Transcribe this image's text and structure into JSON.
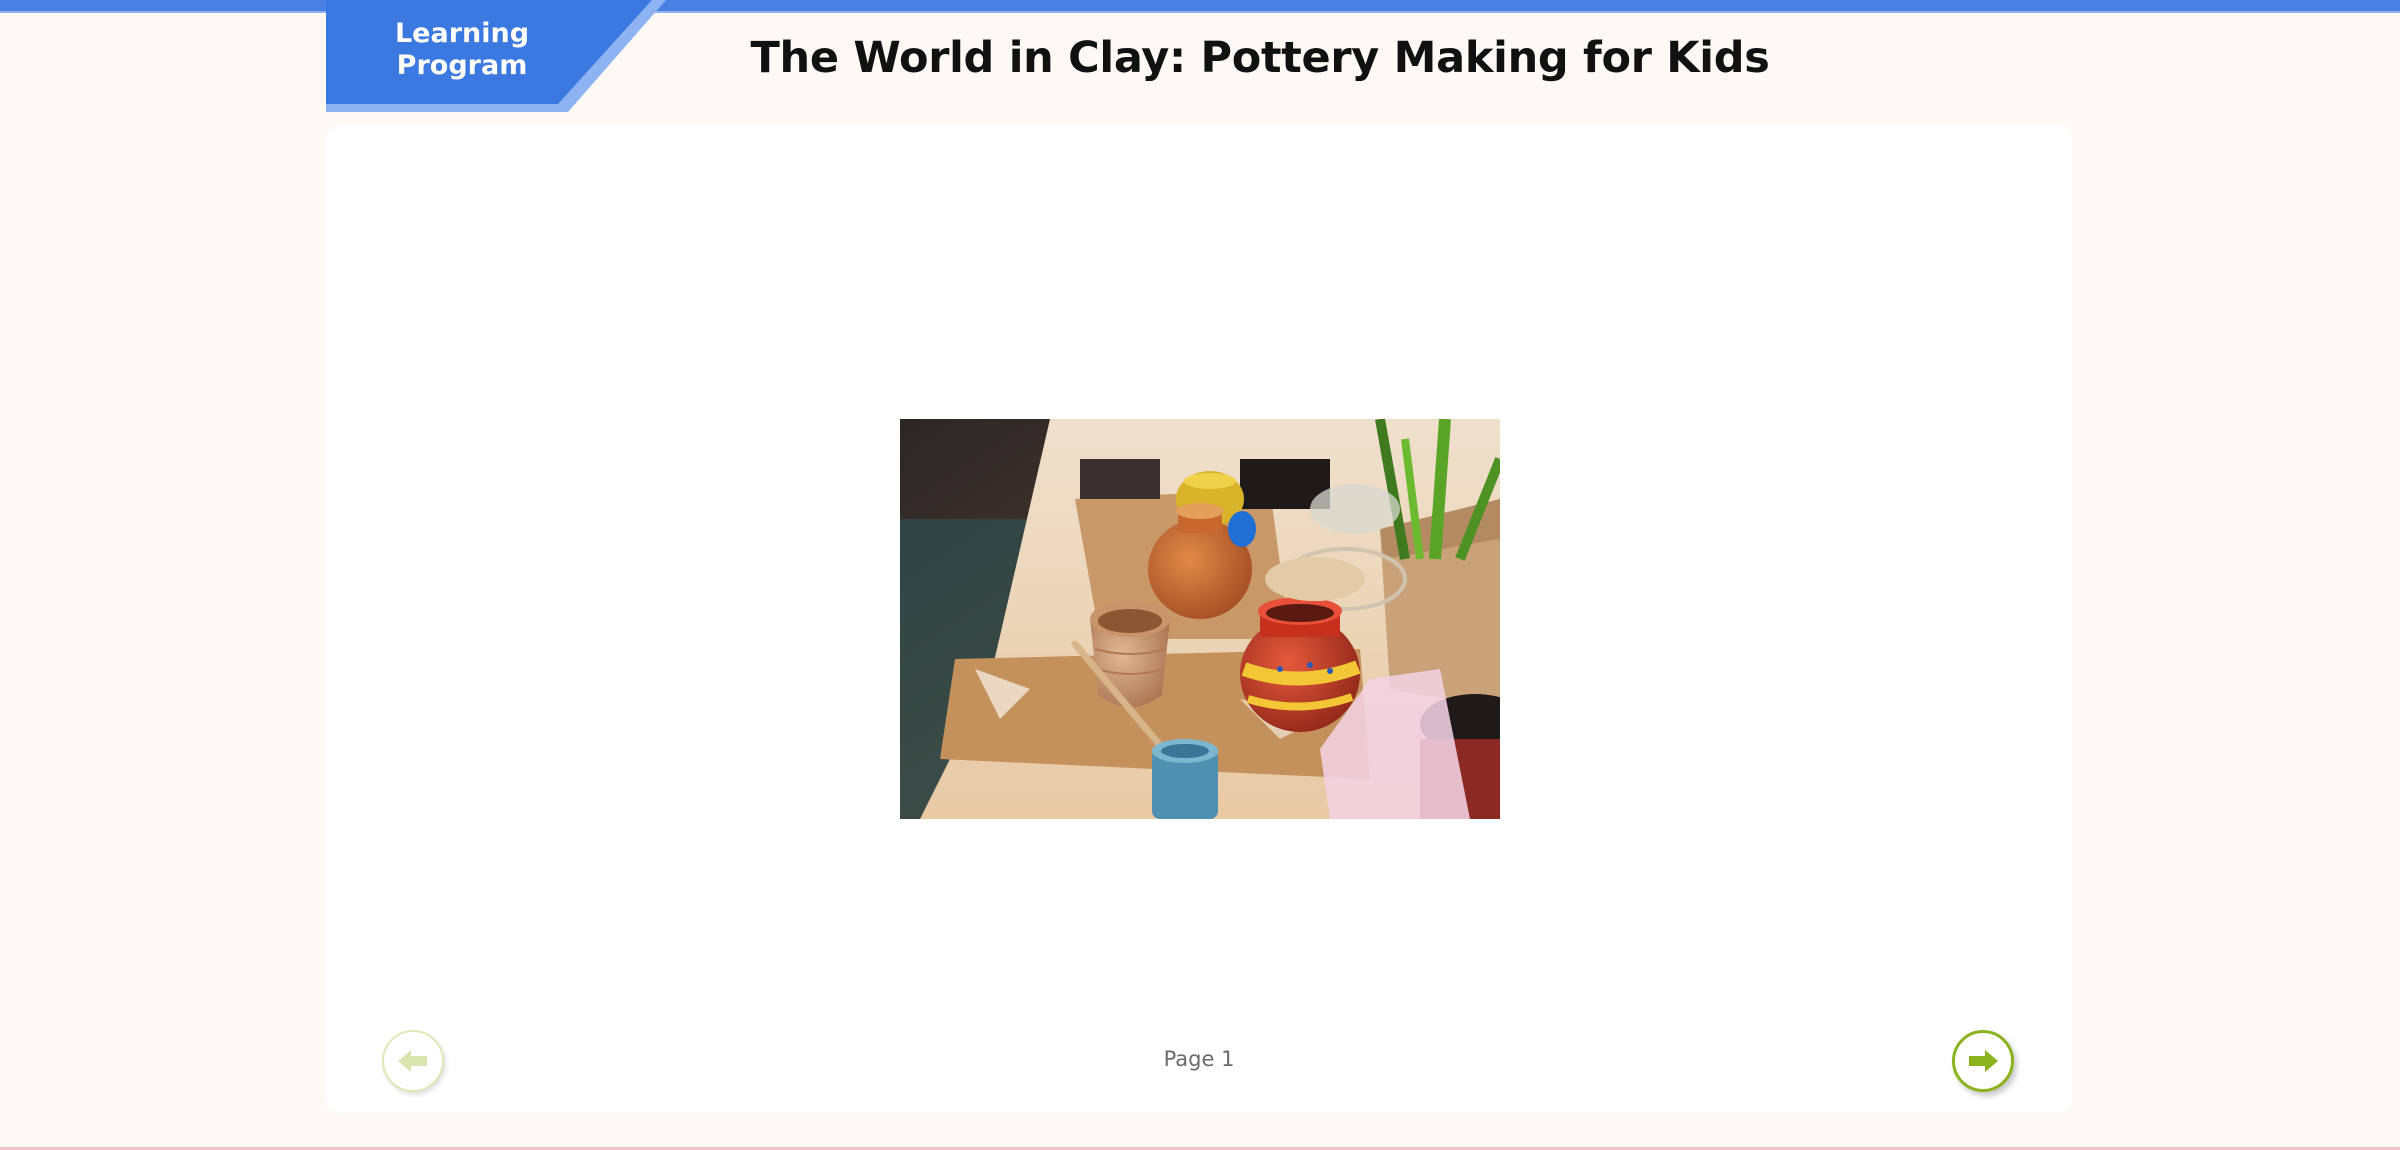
{
  "header": {
    "badge_line1": "Learning",
    "badge_line2": "Program",
    "title": "The World in Clay: Pottery Making for Kids"
  },
  "slide": {
    "image_alt": "Clay pots and painted pottery on a crafts table"
  },
  "footer": {
    "page_label": "Page 1",
    "prev_enabled": false,
    "next_enabled": true
  },
  "colors": {
    "accent_blue": "#4a7fe3",
    "nav_green": "#8ab31e",
    "nav_green_disabled": "#dde8b6",
    "background": "#fff9f5"
  },
  "icons": {
    "prev": "arrow-left-icon",
    "next": "arrow-right-icon"
  }
}
